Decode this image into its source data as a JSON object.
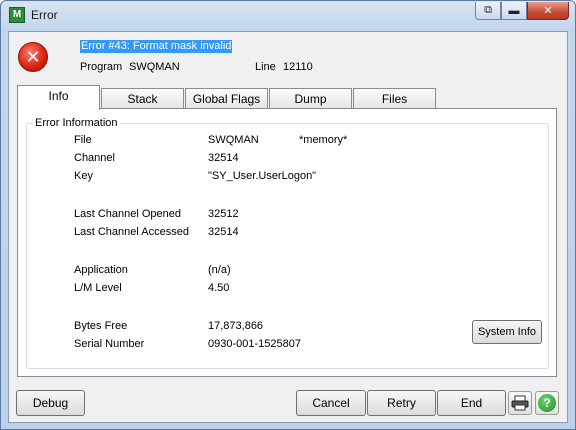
{
  "window": {
    "title": "Error",
    "app_icon_text": "M",
    "controls": {
      "restore": "⧉",
      "minimize": "▬",
      "close": "✕"
    }
  },
  "header": {
    "error_icon": "x-circle-icon",
    "error_title": "Error #43: Format mask invalid",
    "program_label": "Program",
    "program_value": "SWQMAN",
    "line_label": "Line",
    "line_value": "12110"
  },
  "tabs": [
    {
      "label": "Info",
      "active": true
    },
    {
      "label": "Stack"
    },
    {
      "label": "Global Flags"
    },
    {
      "label": "Dump"
    },
    {
      "label": "Files"
    }
  ],
  "info": {
    "group_label": "Error Information",
    "file_label": "File",
    "file_value": "SWQMAN",
    "file_extra": "*memory*",
    "channel_label": "Channel",
    "channel_value": "32514",
    "key_label": "Key",
    "key_value": "\"SY_User.UserLogon\"",
    "last_opened_label": "Last Channel Opened",
    "last_opened_value": "32512",
    "last_accessed_label": "Last Channel Accessed",
    "last_accessed_value": "32514",
    "application_label": "Application",
    "application_value": "(n/a)",
    "lm_level_label": "L/M Level",
    "lm_level_value": "4.50",
    "bytes_free_label": "Bytes Free",
    "bytes_free_value": "17,873,866",
    "serial_label": "Serial Number",
    "serial_value": "0930-001-1525807",
    "system_info_button": "System Info"
  },
  "footer": {
    "debug": "Debug",
    "cancel": "Cancel",
    "retry": "Retry",
    "end": "End",
    "help_glyph": "?"
  }
}
